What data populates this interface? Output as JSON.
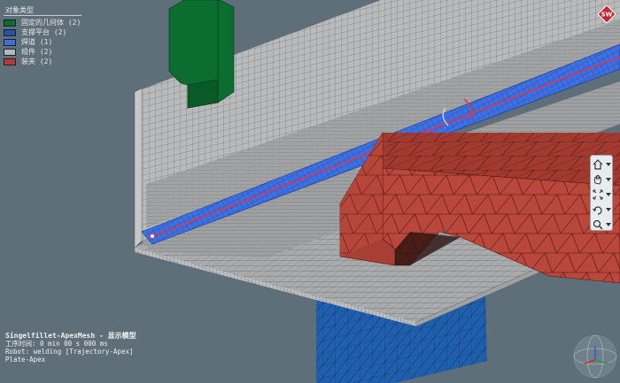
{
  "legend": {
    "title": "对象类型",
    "items": [
      {
        "label": "固定的几何体 (2)",
        "color": "#0d6b2f"
      },
      {
        "label": "支撑平台 (2)",
        "color": "#1f55a8"
      },
      {
        "label": "焊道 (1)",
        "color": "#3b6fe0"
      },
      {
        "label": "组件 (2)",
        "color": "#b5b8bc"
      },
      {
        "label": "装夹 (2)",
        "color": "#b23a3a"
      }
    ]
  },
  "info": {
    "line1": "Singelfillet-ApexMesh - 显示模型",
    "line2": "工序时间: 0 min 00 s 000 ms",
    "line3": "Robot: welding [Trajectory-Apex]",
    "line4": "Plate-Apex"
  },
  "logo": {
    "text": "SW"
  },
  "colors": {
    "background": "#5f6f7a",
    "plate_gray": "#b4b6b8",
    "mesh_line": "#3a3a3a",
    "weld_blue": "#3b6fe0",
    "weld_path": "#e0344a",
    "clamp_red": "#b5453a",
    "fixed_green": "#0d6b2f",
    "support_blue": "#1f55a8"
  },
  "view_tools": [
    {
      "name": "home-view-icon"
    },
    {
      "name": "pan-icon"
    },
    {
      "name": "zoom-fit-icon"
    },
    {
      "name": "rotate-icon"
    },
    {
      "name": "zoom-window-icon"
    }
  ]
}
